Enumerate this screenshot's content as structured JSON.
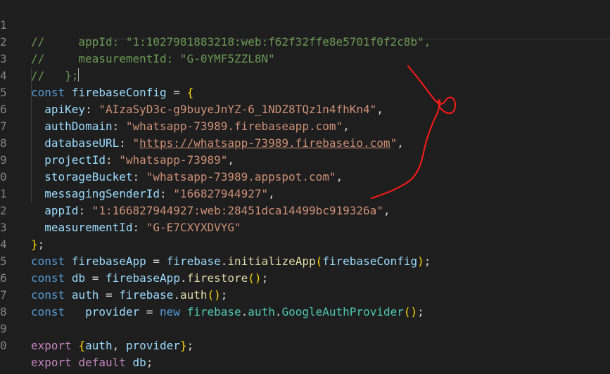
{
  "editor": {
    "line_numbers": [
      "1",
      "2",
      "3",
      "4",
      "5",
      "6",
      "7",
      "8",
      "9",
      "0",
      "1",
      "2",
      "3",
      "4",
      "5",
      "6",
      "7",
      "8",
      "9",
      "0"
    ],
    "lines": {
      "l1": {
        "c1": "//     appId: ",
        "c2": "\"1:1027981883218:web:f62f32ffe8e5701f0f2c8b\"",
        "c3": ","
      },
      "l2": {
        "c1": "//     measurementId: ",
        "c2": "\"G-0YMF5ZZL8N\""
      },
      "l3": {
        "c1": "//   };"
      },
      "l4": {
        "kw": "const",
        "name": "firebaseConfig",
        "eq": " = ",
        "brace": "{"
      },
      "l5": {
        "key": "apiKey",
        "colon": ": ",
        "val": "\"AIzaSyD3c-g9buyeJnYZ-6_1NDZ8TQz1n4fhKn4\"",
        "comma": ","
      },
      "l6": {
        "key": "authDomain",
        "colon": ": ",
        "val": "\"whatsapp-73989.firebaseapp.com\"",
        "comma": ","
      },
      "l7": {
        "key": "databaseURL",
        "colon": ": ",
        "q1": "\"",
        "url": "https://whatsapp-73989.firebaseio.com",
        "q2": "\"",
        "comma": ","
      },
      "l8": {
        "key": "projectId",
        "colon": ": ",
        "val": "\"whatsapp-73989\"",
        "comma": ","
      },
      "l9": {
        "key": "storageBucket",
        "colon": ": ",
        "val": "\"whatsapp-73989.appspot.com\"",
        "comma": ","
      },
      "l10": {
        "key": "messagingSenderId",
        "colon": ": ",
        "val": "\"166827944927\"",
        "comma": ","
      },
      "l11": {
        "key": "appId",
        "colon": ": ",
        "val": "\"1:166827944927:web:28451dca14499bc919326a\"",
        "comma": ","
      },
      "l12": {
        "key": "measurementId",
        "colon": ": ",
        "val": "\"G-E7CXYXDVYG\""
      },
      "l13": {
        "brace": "}",
        "semi": ";"
      },
      "l14": {
        "kw": "const",
        "name": "firebaseApp",
        "eq": " = ",
        "obj": "firebase",
        "dot": ".",
        "fn": "initializeApp",
        "p1": "(",
        "arg": "firebaseConfig",
        "p2": ")",
        "semi": ";"
      },
      "l15": {
        "kw": "const",
        "name": "db",
        "eq": " = ",
        "obj": "firebaseApp",
        "dot": ".",
        "fn": "firestore",
        "p": "()",
        "semi": ";"
      },
      "l16": {
        "kw": "const",
        "name": "auth",
        "eq": " = ",
        "obj": "firebase",
        "dot": ".",
        "fn": "auth",
        "p": "()",
        "semi": ";"
      },
      "l17": {
        "kw": "const",
        "sp": "  ",
        "name": "provider",
        "eq": " = ",
        "new": "new",
        "obj": "firebase",
        "dot1": ".",
        "prop": "auth",
        "dot2": ".",
        "cls": "GoogleAuthProvider",
        "p": "()",
        "semi": ";"
      },
      "l19": {
        "kw": "export",
        "b1": "{",
        "a": "auth",
        "comma": ", ",
        "b": "provider",
        "b2": "}",
        "semi": ";"
      },
      "l20": {
        "kw": "export",
        "kw2": "default",
        "name": "db",
        "semi": ";"
      }
    }
  },
  "annotation_color": "#ff1a1a"
}
